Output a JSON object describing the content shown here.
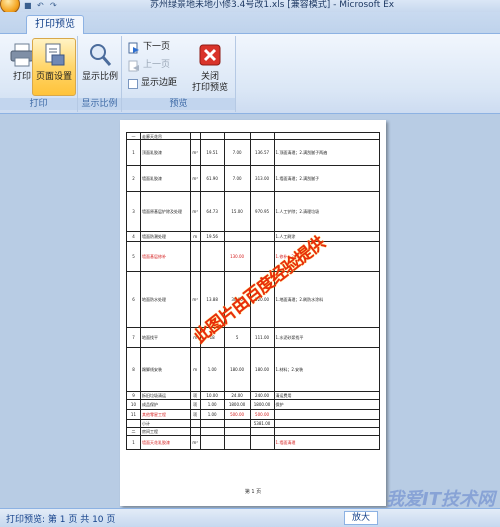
{
  "window": {
    "title": "苏州绿景地未地小修3.4号改1.xls [兼容模式] - Microsoft Ex"
  },
  "ribbon": {
    "tab_label": "打印预览",
    "print_label": "打印",
    "page_setup_label": "页面设置",
    "zoom_label": "显示比例",
    "next_page_label": "下一页",
    "prev_page_label": "上一页",
    "show_margins_label": "显示边距",
    "close_label": "关闭",
    "close_label2": "打印预览",
    "groups": {
      "print": "打印",
      "zoom": "显示比例",
      "preview": "预览"
    }
  },
  "sheet": {
    "rows": [
      {
        "c1": "一",
        "c2": "走廊天花吊",
        "c3": "",
        "c4": "",
        "c5": "",
        "c6": "",
        "c7": "",
        "red": false
      },
      {
        "c1": "1",
        "c2": "顶面乳胶漆",
        "c3": "m²",
        "c4": "19.51",
        "c5": "7.00",
        "c6": "136.57",
        "c7": "1.顶面清理；2.满刮腻子两遍",
        "red": false
      },
      {
        "c1": "2",
        "c2": "墙面乳胶漆",
        "c3": "m²",
        "c4": "61.90",
        "c5": "7.00",
        "c6": "313.00",
        "c7": "1.墙面清理；2.满刮腻子",
        "red": false
      },
      {
        "c1": "3",
        "c2": "墙面原基层铲除及处理",
        "c3": "m²",
        "c4": "64.73",
        "c5": "15.00",
        "c6": "970.95",
        "c7": "1.人工铲除；2.清理垃圾",
        "red": false
      },
      {
        "c1": "4",
        "c2": "墙面防潮处理",
        "c3": "m",
        "c4": "19.56",
        "c5": "",
        "c6": "",
        "c7": "1.人工刷涂",
        "red": false
      },
      {
        "c1": "5",
        "c2": "墙面基层修补",
        "c3": "",
        "c4": "",
        "c5": "130.00",
        "c6": "",
        "c7": "1.修补；2.找平",
        "red": true
      },
      {
        "c1": "6",
        "c2": "地面防水处理",
        "c3": "m²",
        "c4": "13.88",
        "c5": "30.00",
        "c6": "520.00",
        "c7": "1.地面清理；2.刷防水涂料",
        "red": false
      },
      {
        "c1": "7",
        "c2": "地面找平",
        "c3": "m",
        "c4": "18",
        "c5": "5",
        "c6": "111.00",
        "c7": "1.水泥砂浆找平",
        "red": false
      },
      {
        "c1": "8",
        "c2": "踢脚线安装",
        "c3": "m",
        "c4": "1.00",
        "c5": "180.00",
        "c6": "180.00",
        "c7": "1.材料；2.安装",
        "red": false
      },
      {
        "c1": "9",
        "c2": "拆旧垃圾清运",
        "c3": "项",
        "c4": "10.00",
        "c5": "24.00",
        "c6": "240.00",
        "c7": "清运费用",
        "red": false
      },
      {
        "c1": "10",
        "c2": "成品保护",
        "c3": "项",
        "c4": "1.00",
        "c5": "1800.00",
        "c6": "1800.00",
        "c7": "保护",
        "red": false
      },
      {
        "c1": "11",
        "c2": "其他零星工程",
        "c3": "项",
        "c4": "1.00",
        "c5": "500.00",
        "c6": "500.00",
        "c7": "",
        "red": true
      },
      {
        "c1": "",
        "c2": "小计",
        "c3": "",
        "c4": "",
        "c5": "",
        "c6": "5381.00",
        "c7": "",
        "red": false
      },
      {
        "c1": "二",
        "c2": "房间工程",
        "c3": "",
        "c4": "",
        "c5": "",
        "c6": "",
        "c7": "",
        "red": false
      },
      {
        "c1": "1",
        "c2": "墙面天花乳胶漆",
        "c3": "m²",
        "c4": "",
        "c5": "",
        "c6": "",
        "c7": "1.墙面清理",
        "red": true
      }
    ],
    "page_label": "第 1 页",
    "stamp": "此图片由百度经验提供"
  },
  "status": {
    "text": "打印预览: 第 1 页 共 10 页",
    "zoom_button": "放大"
  },
  "watermark": "我爱IT技术网"
}
